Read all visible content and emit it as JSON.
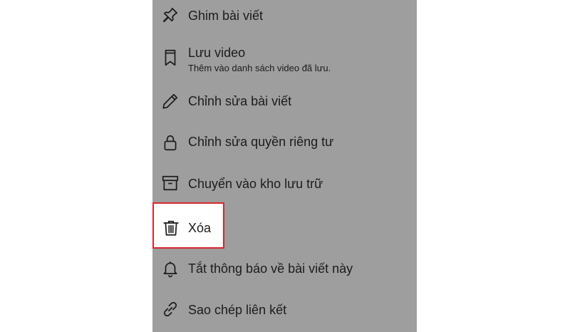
{
  "menu": {
    "items": [
      {
        "label": "Ghim bài viết",
        "icon": "pin-icon"
      },
      {
        "label": "Lưu video",
        "sublabel": "Thêm vào danh sách video đã lưu.",
        "icon": "bookmark-icon"
      },
      {
        "label": "Chỉnh sửa bài viết",
        "icon": "pencil-icon"
      },
      {
        "label": "Chỉnh sửa quyền riêng tư",
        "icon": "lock-icon"
      },
      {
        "label": "Chuyển vào kho lưu trữ",
        "icon": "archive-icon"
      },
      {
        "label": "Xóa",
        "icon": "trash-icon",
        "highlighted": true
      },
      {
        "label": "Tắt thông báo về bài viết này",
        "icon": "bell-icon"
      },
      {
        "label": "Sao chép liên kết",
        "icon": "link-icon"
      }
    ]
  },
  "colors": {
    "sheet_background": "#9e9e9e",
    "highlight_border": "#d6262f",
    "text": "#1c1c1c"
  }
}
